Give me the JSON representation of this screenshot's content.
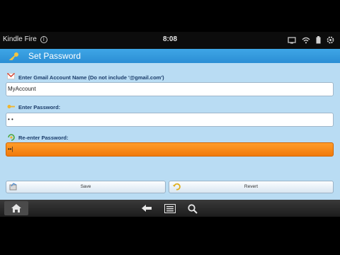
{
  "status_bar": {
    "device_name": "Kindle Fire",
    "time": "8:08",
    "icons": [
      "info-icon",
      "cast-icon",
      "wifi-icon",
      "battery-icon",
      "settings-icon"
    ]
  },
  "action_bar": {
    "title": "Set Password",
    "icon": "key-icon"
  },
  "form": {
    "account": {
      "label": "Enter Gmail Account Name (Do not include '@gmail.com')",
      "value": "MyAccount",
      "icon": "gmail-icon"
    },
    "password": {
      "label": "Enter Password:",
      "value": "• •",
      "icon": "key-icon"
    },
    "reenter": {
      "label": "Re-enter Password:",
      "value": "••|",
      "icon": "refresh-key-icon",
      "focus_color": "#f58a16"
    }
  },
  "buttons": {
    "save_label": "Save",
    "revert_label": "Revert"
  },
  "nav_bar": {
    "icons": [
      "home-icon",
      "back-icon",
      "menu-icon",
      "search-icon"
    ]
  },
  "colors": {
    "accent": "#2b8ed4",
    "background": "#b9dcf3",
    "focus": "#f58a16"
  }
}
